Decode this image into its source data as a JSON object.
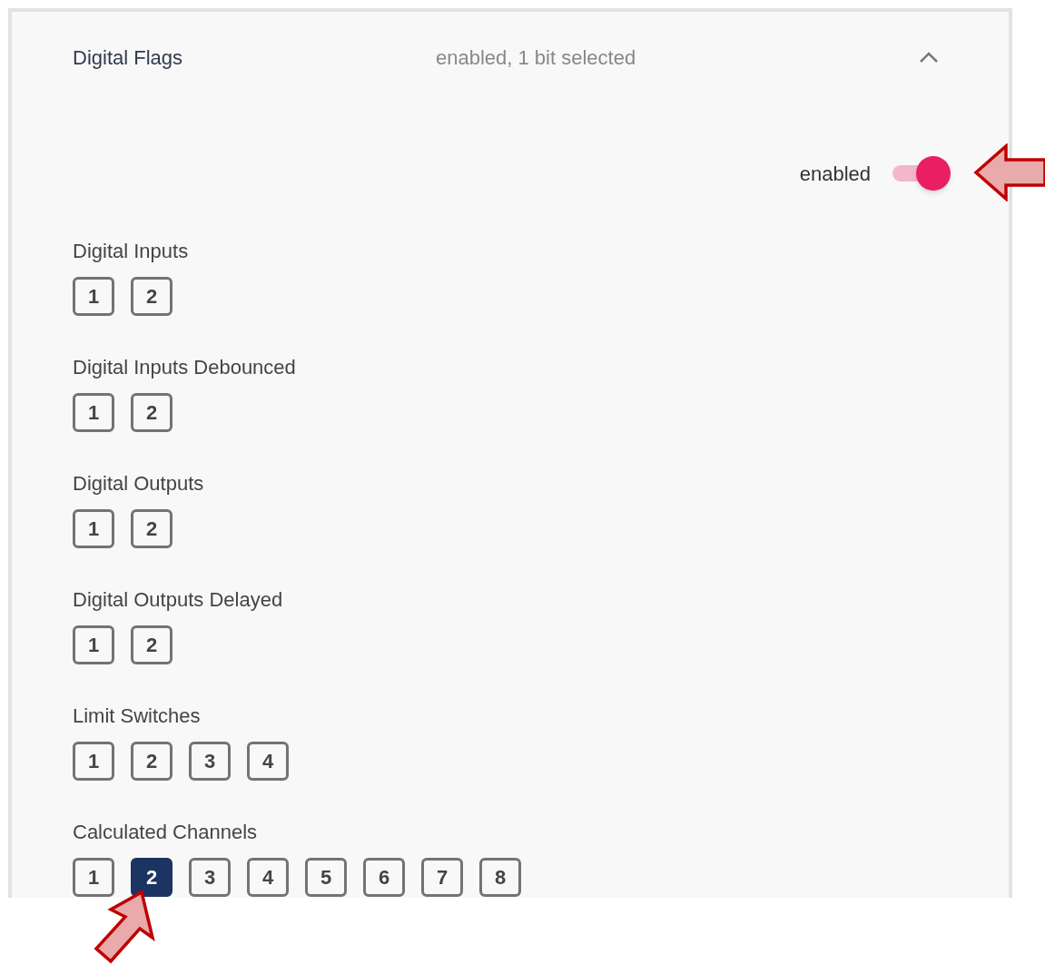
{
  "panel": {
    "title": "Digital Flags",
    "summary": "enabled, 1 bit selected",
    "expanded": true
  },
  "toggle": {
    "label": "enabled",
    "on": true
  },
  "groups": [
    {
      "label": "Digital Inputs",
      "bits": [
        {
          "label": "1",
          "selected": false
        },
        {
          "label": "2",
          "selected": false
        }
      ]
    },
    {
      "label": "Digital Inputs Debounced",
      "bits": [
        {
          "label": "1",
          "selected": false
        },
        {
          "label": "2",
          "selected": false
        }
      ]
    },
    {
      "label": "Digital Outputs",
      "bits": [
        {
          "label": "1",
          "selected": false
        },
        {
          "label": "2",
          "selected": false
        }
      ]
    },
    {
      "label": "Digital Outputs Delayed",
      "bits": [
        {
          "label": "1",
          "selected": false
        },
        {
          "label": "2",
          "selected": false
        }
      ]
    },
    {
      "label": "Limit Switches",
      "bits": [
        {
          "label": "1",
          "selected": false
        },
        {
          "label": "2",
          "selected": false
        },
        {
          "label": "3",
          "selected": false
        },
        {
          "label": "4",
          "selected": false
        }
      ]
    },
    {
      "label": "Calculated Channels",
      "bits": [
        {
          "label": "1",
          "selected": false
        },
        {
          "label": "2",
          "selected": true
        },
        {
          "label": "3",
          "selected": false
        },
        {
          "label": "4",
          "selected": false
        },
        {
          "label": "5",
          "selected": false
        },
        {
          "label": "6",
          "selected": false
        },
        {
          "label": "7",
          "selected": false
        },
        {
          "label": "8",
          "selected": false
        }
      ]
    }
  ]
}
